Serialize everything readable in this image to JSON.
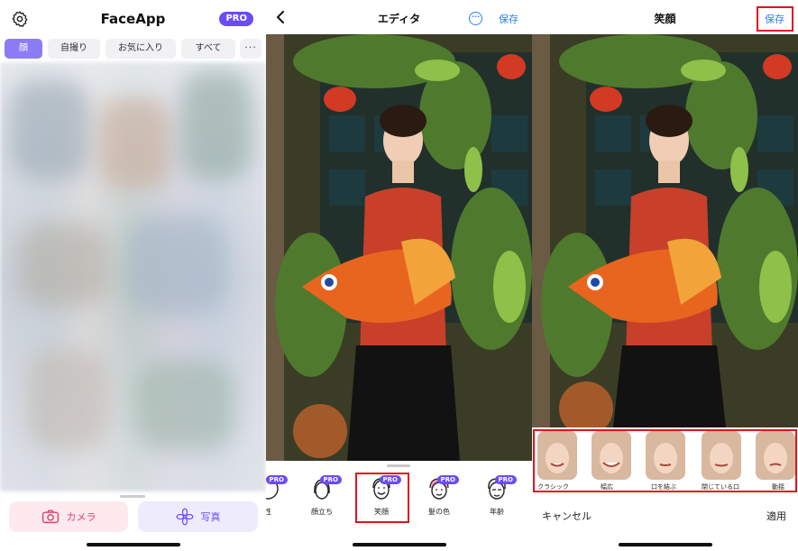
{
  "panel1": {
    "app_title": "FaceApp",
    "pro_badge": "PRO",
    "chips": [
      "顔",
      "自撮り",
      "お気に入り",
      "すべて"
    ],
    "more": "···",
    "camera_label": "カメラ",
    "photo_label": "写真",
    "colors": {
      "accent": "#6b4bf5",
      "camera": "#e0426b"
    }
  },
  "panel2": {
    "title": "エディタ",
    "save": "保存",
    "tools": [
      {
        "label": "性",
        "pro": "PRO",
        "icon": "face-gender-icon"
      },
      {
        "label": "顔立ち",
        "pro": "PRO",
        "icon": "face-features-icon"
      },
      {
        "label": "笑顔",
        "pro": "PRO",
        "icon": "face-smile-icon"
      },
      {
        "label": "髪の色",
        "pro": "PRO",
        "icon": "face-hair-color-icon"
      },
      {
        "label": "年齢",
        "pro": "PRO",
        "icon": "face-age-icon"
      }
    ]
  },
  "panel3": {
    "title": "笑顔",
    "save": "保存",
    "options": [
      "クラシック",
      "幅広",
      "口を結ぶ",
      "閉じている口",
      "動揺"
    ],
    "cancel": "キャンセル",
    "apply": "適用"
  }
}
